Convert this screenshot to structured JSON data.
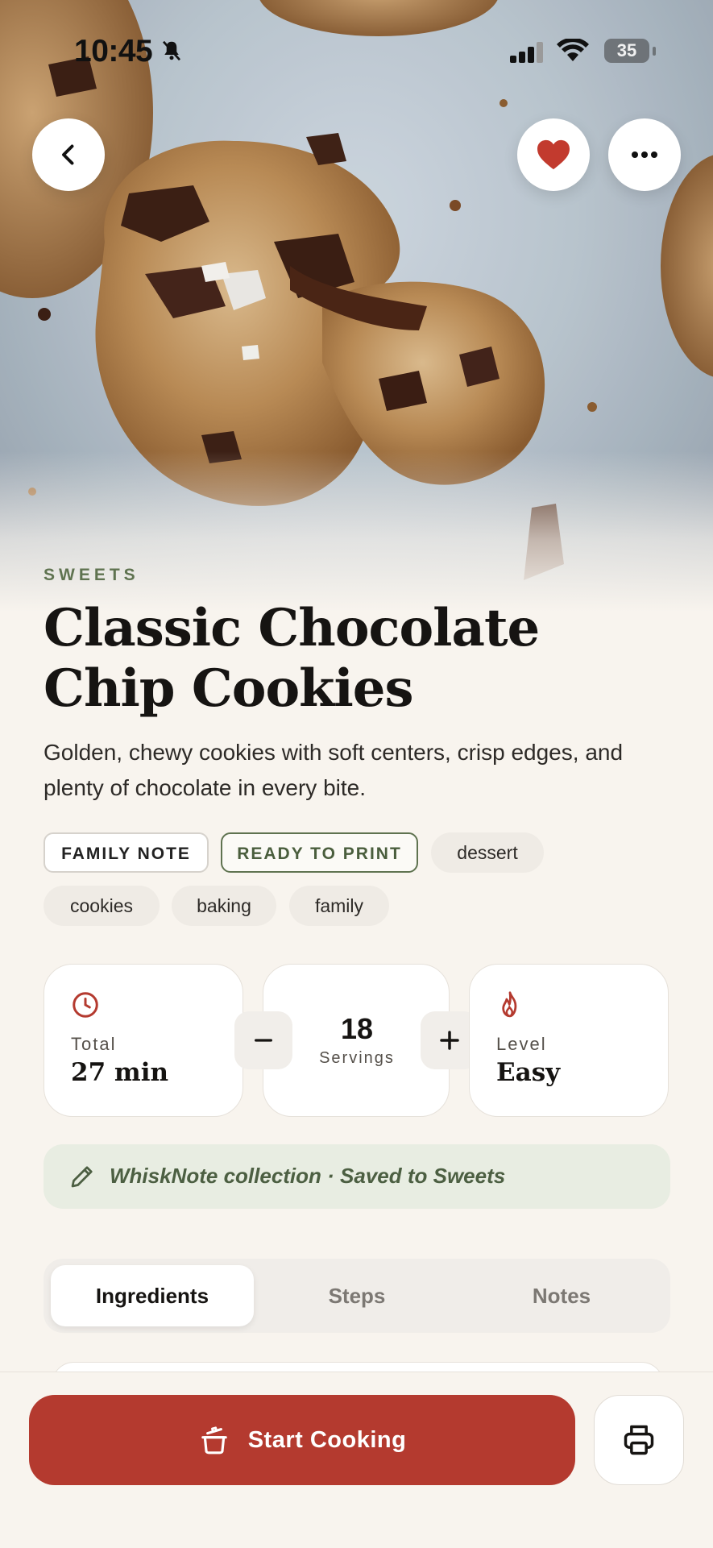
{
  "status_bar": {
    "time": "10:45",
    "battery": "35"
  },
  "recipe": {
    "category": "SWEETS",
    "title": "Classic Chocolate Chip Cookies",
    "description": "Golden, chewy cookies with soft centers, crisp edges, and plenty of chocolate in every bite."
  },
  "tags": {
    "family_note": "FAMILY NOTE",
    "ready_to_print": "READY TO PRINT",
    "items": [
      "dessert",
      "cookies",
      "baking",
      "family"
    ]
  },
  "stats": {
    "total_label": "Total",
    "total_value": "27 min",
    "servings_value": "18",
    "servings_label": "Servings",
    "level_label": "Level",
    "level_value": "Easy"
  },
  "collection": {
    "text": "WhiskNote collection · Saved to Sweets"
  },
  "tabs": [
    "Ingredients",
    "Steps",
    "Notes"
  ],
  "active_tab": "Ingredients",
  "actions": {
    "start_cooking": "Start Cooking"
  },
  "colors": {
    "accent_red": "#b43a2f",
    "heart_red": "#c23a2e",
    "category_green": "#5f7350",
    "background": "#f8f4ee"
  },
  "icons": {
    "back": "chevron-left-icon",
    "favorite": "heart-icon",
    "more": "more-horizontal-icon",
    "total_time": "clock-icon",
    "level": "flame-icon",
    "decrease": "minus-icon",
    "increase": "plus-icon",
    "collection": "pencil-icon",
    "start": "pot-icon",
    "print": "printer-icon"
  }
}
